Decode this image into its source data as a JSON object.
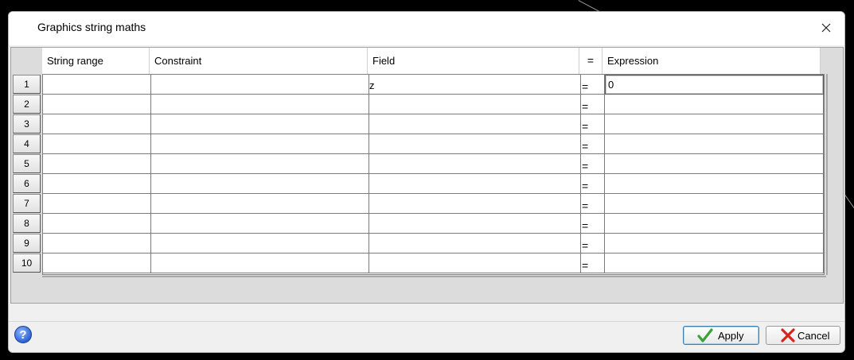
{
  "window": {
    "title": "Graphics string maths"
  },
  "table": {
    "columns": [
      "String range",
      "Constraint",
      "Field",
      "=",
      "Expression"
    ],
    "rows": [
      {
        "num": "1",
        "string_range": "",
        "constraint": "",
        "field": "z",
        "eq": "=",
        "expression": "0"
      },
      {
        "num": "2",
        "string_range": "",
        "constraint": "",
        "field": "",
        "eq": "=",
        "expression": ""
      },
      {
        "num": "3",
        "string_range": "",
        "constraint": "",
        "field": "",
        "eq": "=",
        "expression": ""
      },
      {
        "num": "4",
        "string_range": "",
        "constraint": "",
        "field": "",
        "eq": "=",
        "expression": ""
      },
      {
        "num": "5",
        "string_range": "",
        "constraint": "",
        "field": "",
        "eq": "=",
        "expression": ""
      },
      {
        "num": "6",
        "string_range": "",
        "constraint": "",
        "field": "",
        "eq": "=",
        "expression": ""
      },
      {
        "num": "7",
        "string_range": "",
        "constraint": "",
        "field": "",
        "eq": "=",
        "expression": ""
      },
      {
        "num": "8",
        "string_range": "",
        "constraint": "",
        "field": "",
        "eq": "=",
        "expression": ""
      },
      {
        "num": "9",
        "string_range": "",
        "constraint": "",
        "field": "",
        "eq": "=",
        "expression": ""
      },
      {
        "num": "10",
        "string_range": "",
        "constraint": "",
        "field": "",
        "eq": "=",
        "expression": ""
      }
    ]
  },
  "buttons": {
    "apply": "Apply",
    "cancel": "Cancel"
  },
  "icons": {
    "help": "help-icon",
    "close": "close-icon",
    "apply": "check-icon",
    "cancel": "x-icon"
  },
  "colors": {
    "apply_check": "#3aa33a",
    "cancel_x": "#d8231f",
    "help_blue": "#2d63d6"
  }
}
